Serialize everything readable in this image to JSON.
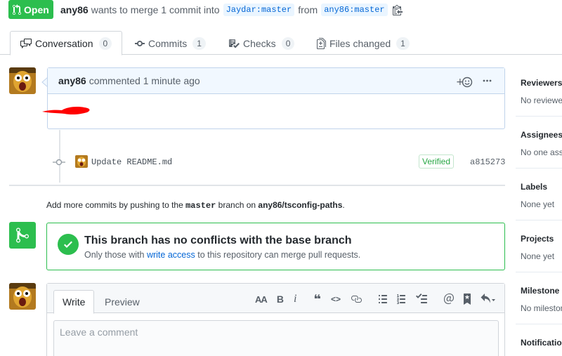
{
  "header": {
    "state": "Open",
    "author": "any86",
    "merge_text": "wants to merge 1 commit into",
    "base_branch": "Jaydar:master",
    "from_text": "from",
    "head_branch": "any86:master"
  },
  "tabs": [
    {
      "label": "Conversation",
      "count": "0"
    },
    {
      "label": "Commits",
      "count": "1"
    },
    {
      "label": "Checks",
      "count": "0"
    },
    {
      "label": "Files changed",
      "count": "1"
    }
  ],
  "comment": {
    "author": "any86",
    "action_text": "commented 1 minute ago",
    "add_reaction": "+☺",
    "more": "···"
  },
  "commit": {
    "message": "Update README.md",
    "verified": "Verified",
    "sha": "a815273"
  },
  "push_hint": {
    "prefix": "Add more commits by pushing to the",
    "branch": "master",
    "middle": "branch on",
    "repo": "any86/tsconfig-paths",
    "suffix": "."
  },
  "merge": {
    "title": "This branch has no conflicts with the base branch",
    "sub_prefix": "Only those with",
    "sub_link": "write access",
    "sub_suffix": "to this repository can merge pull requests."
  },
  "editor": {
    "write_tab": "Write",
    "preview_tab": "Preview",
    "placeholder": "Leave a comment",
    "toolbar": {
      "header": "AA",
      "bold": "B",
      "italic": "i",
      "quote": "❝",
      "code": "<>"
    }
  },
  "sidebar": {
    "sections": [
      {
        "label": "Reviewers",
        "value": "No reviewers"
      },
      {
        "label": "Assignees",
        "value": "No one assigned"
      },
      {
        "label": "Labels",
        "value": "None yet"
      },
      {
        "label": "Projects",
        "value": "None yet"
      },
      {
        "label": "Milestone",
        "value": "No milestone"
      },
      {
        "label": "Notifications",
        "value": ""
      }
    ]
  },
  "colors": {
    "open_green": "#2cbe4e",
    "link_blue": "#0366d6",
    "comment_header_bg": "#f1f8ff",
    "redaction_red": "#ff0000"
  }
}
